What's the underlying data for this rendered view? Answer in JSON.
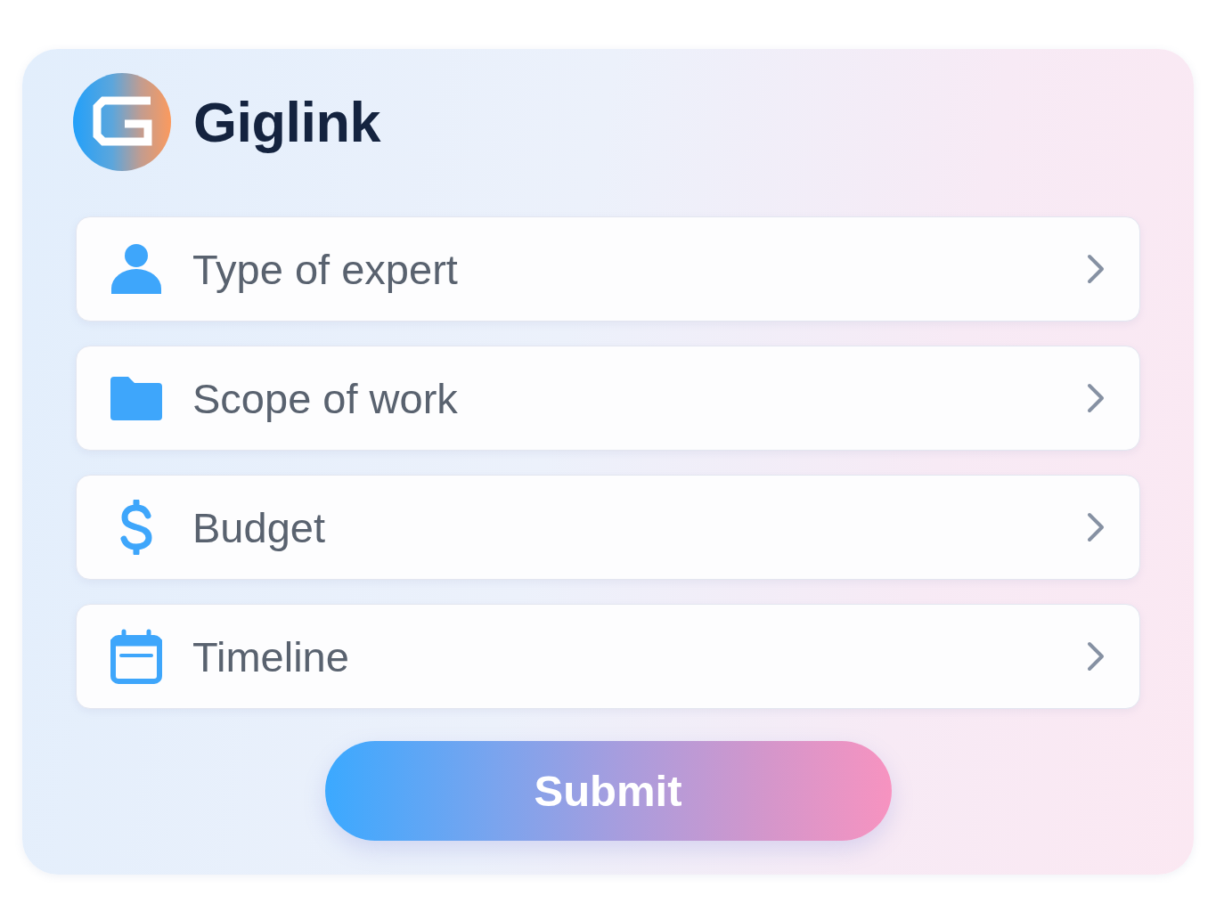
{
  "brand": {
    "name": "Giglink"
  },
  "fields": [
    {
      "kind": "person",
      "label": "Type of expert"
    },
    {
      "kind": "folder",
      "label": "Scope of work"
    },
    {
      "kind": "dollar",
      "label": "Budget"
    },
    {
      "kind": "calendar",
      "label": "Timeline"
    }
  ],
  "submit": {
    "label": "Submit"
  }
}
